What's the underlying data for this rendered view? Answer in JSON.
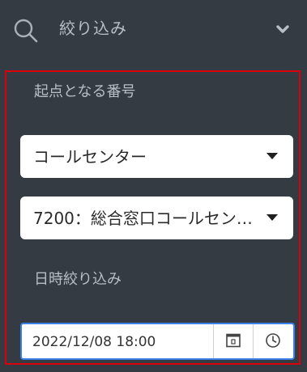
{
  "filter": {
    "title": "絞り込み",
    "search_icon": "search-icon",
    "toggle_icon": "chevron-down-icon"
  },
  "panel": {
    "highlight_color": "#d9000c",
    "origin_label": "起点となる番号",
    "category_select": {
      "value": "コールセンター"
    },
    "number_select": {
      "value": "7200：総合窓口コールセン…"
    },
    "date_label": "日時絞り込み",
    "datetime_input": {
      "value": "2022/12/08 18:00",
      "focus_color": "#3e80e8"
    },
    "calendar_icon": "calendar-icon",
    "clock_icon": "clock-icon"
  }
}
